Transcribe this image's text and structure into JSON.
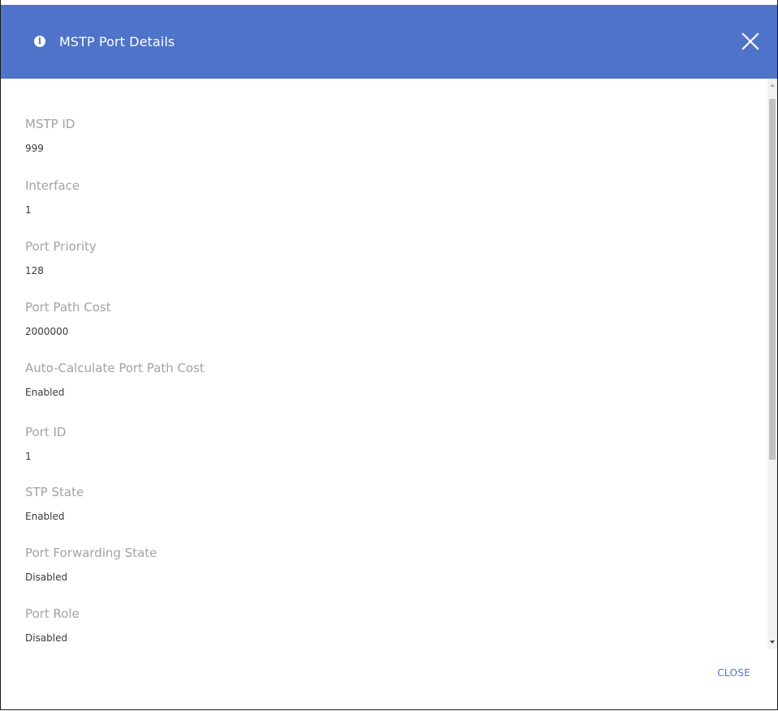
{
  "dialog": {
    "title": "MSTP Port Details",
    "header_icon": "info-icon",
    "header_icon_glyph": "i",
    "close_icon": "close-icon",
    "accent_color": "#4e73c8",
    "footer_close_label": "CLOSE"
  },
  "fields": [
    {
      "label": "MSTP ID",
      "value": "999"
    },
    {
      "label": "Interface",
      "value": "1"
    },
    {
      "label": "Port Priority",
      "value": "128"
    },
    {
      "label": "Port Path Cost",
      "value": "2000000"
    },
    {
      "label": "Auto-Calculate Port Path Cost",
      "value": "Enabled"
    },
    {
      "label": "Port ID",
      "value": "1"
    },
    {
      "label": "STP State",
      "value": "Enabled"
    },
    {
      "label": "Port Forwarding State",
      "value": "Disabled"
    },
    {
      "label": "Port Role",
      "value": "Disabled"
    }
  ]
}
